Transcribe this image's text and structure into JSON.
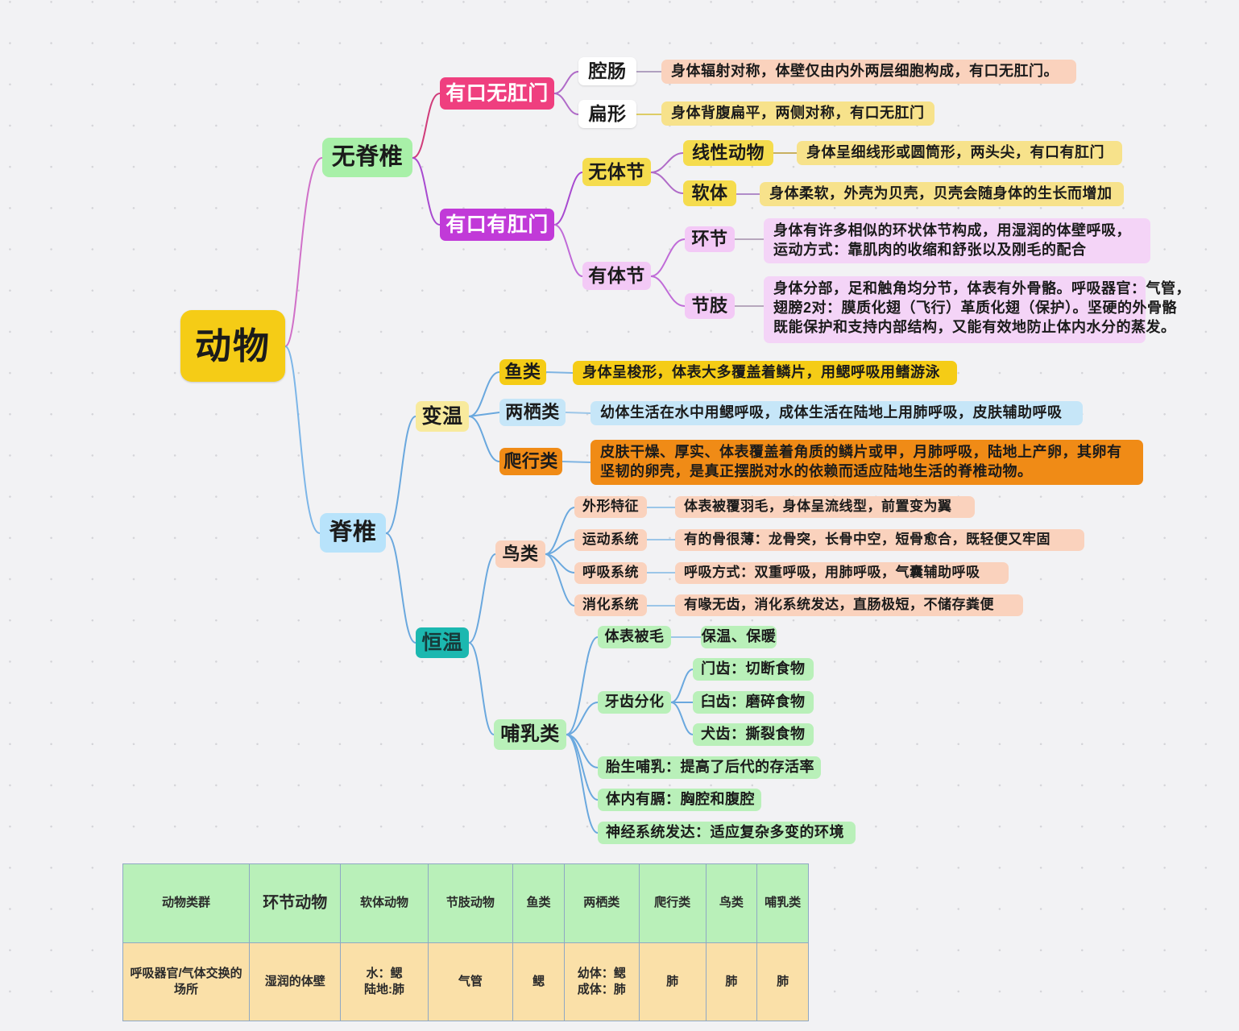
{
  "root": {
    "label": "动物"
  },
  "branches": {
    "invertebrate": {
      "label": "无脊椎"
    },
    "vertebrate": {
      "label": "脊椎"
    }
  },
  "invertebrate": {
    "no_anus": {
      "label": "有口无肛门",
      "children": [
        {
          "label": "腔肠",
          "desc": "身体辐射对称，体壁仅由内外两层细胞构成，有口无肛门。"
        },
        {
          "label": "扁形",
          "desc": "身体背腹扁平，两侧对称，有口无肛门"
        }
      ]
    },
    "with_anus": {
      "label": "有口有肛门",
      "groups": [
        {
          "label": "无体节",
          "children": [
            {
              "label": "线性动物",
              "desc": "身体呈细线形或圆筒形，两头尖，有口有肛门"
            },
            {
              "label": "软体",
              "desc": "身体柔软，外壳为贝壳，贝壳会随身体的生长而增加"
            }
          ]
        },
        {
          "label": "有体节",
          "children": [
            {
              "label": "环节",
              "desc_line1": "身体有许多相似的环状体节构成，用湿润的体壁呼吸，",
              "desc_line2": "运动方式：靠肌肉的收缩和舒张以及刚毛的配合"
            },
            {
              "label": "节肢",
              "desc_line1": "身体分部，足和触角均分节，体表有外骨骼。呼吸器官：气管，",
              "desc_line2": "翅膀2对：膜质化翅（飞行）革质化翅（保护）。坚硬的外骨骼",
              "desc_line3": "既能保护和支持内部结构，又能有效地防止体内水分的蒸发。"
            }
          ]
        }
      ]
    }
  },
  "vertebrate": {
    "poikilo": {
      "label": "变温",
      "children": [
        {
          "label": "鱼类",
          "desc": "身体呈梭形，体表大多覆盖着鳞片，用鳃呼吸用鳍游泳"
        },
        {
          "label": "两栖类",
          "desc": "幼体生活在水中用鳃呼吸，成体生活在陆地上用肺呼吸，皮肤辅助呼吸"
        },
        {
          "label": "爬行类",
          "desc_line1": "皮肤干燥、厚实、体表覆盖着角质的鳞片或甲，月肺呼吸，陆地上产卵，其卵有",
          "desc_line2": "坚韧的卵壳，是真正摆脱对水的依赖而适应陆地生活的脊椎动物。"
        }
      ]
    },
    "homeo": {
      "label": "恒温",
      "birds": {
        "label": "鸟类",
        "items": [
          {
            "label": "外形特征",
            "desc": "体表被覆羽毛，身体呈流线型，前置变为翼"
          },
          {
            "label": "运动系统",
            "desc": "有的骨很薄：龙骨突，长骨中空，短骨愈合，既轻便又牢固"
          },
          {
            "label": "呼吸系统",
            "desc": "呼吸方式：双重呼吸，用肺呼吸，气囊辅助呼吸"
          },
          {
            "label": "消化系统",
            "desc": "有喙无齿，消化系统发达，直肠极短，不储存粪便"
          }
        ]
      },
      "mammals": {
        "label": "哺乳类",
        "fur": {
          "label": "体表被毛",
          "desc": "保温、保暖"
        },
        "teeth": {
          "label": "牙齿分化",
          "items": [
            {
              "label": "门齿：切断食物"
            },
            {
              "label": "臼齿：磨碎食物"
            },
            {
              "label": "犬齿：撕裂食物"
            }
          ]
        },
        "others": [
          {
            "label": "胎生哺乳：提高了后代的存活率"
          },
          {
            "label": "体内有膈：胸腔和腹腔"
          },
          {
            "label": "神经系统发达：适应复杂多变的环境"
          }
        ]
      }
    }
  },
  "table": {
    "header": [
      "动物类群",
      "环节动物",
      "软体动物",
      "节肢动物",
      "鱼类",
      "两栖类",
      "爬行类",
      "鸟类",
      "哺乳类"
    ],
    "row1": [
      "呼吸器官/气体交换的场所",
      "湿润的体壁",
      "水：鳃\n陆地:肺",
      "气管",
      "鳃",
      "幼体：鳃\n成体：肺",
      "肺",
      "肺",
      "肺"
    ]
  },
  "colors": {
    "root": "#f5cc16",
    "invertebrate": "#a8f0a8",
    "vertebrate": "#b8e3fb",
    "no_anus": "#ef3f7f",
    "with_anus": "#c13ad8",
    "yellow": "#f5dc4e",
    "pink": "#f3c9f6",
    "peach": "#fad2bd",
    "orange": "#f08b16",
    "lightblue": "#c6e6f8",
    "teal": "#1cb8b0",
    "green": "#b9f0b9",
    "table_header": "#b9f0b9",
    "table_row": "#fae0a8",
    "canvas": "#f2f2f4"
  }
}
